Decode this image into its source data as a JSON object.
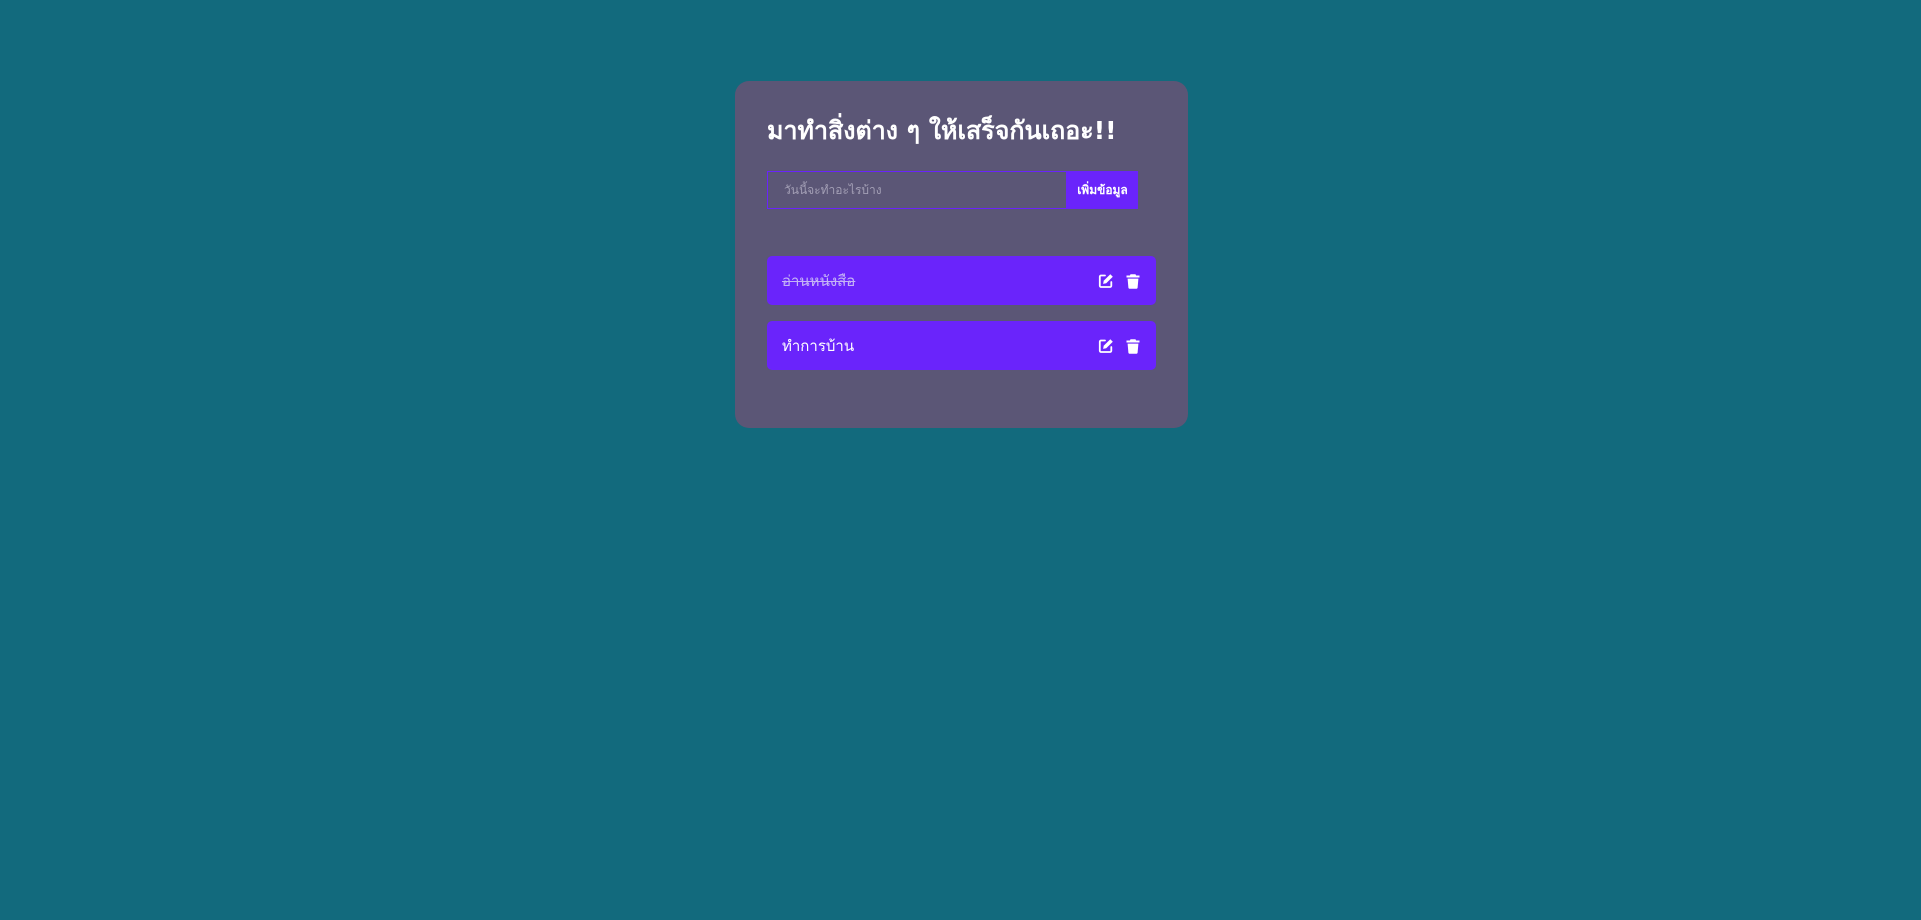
{
  "app": {
    "title": "มาทำสิ่งต่าง ๆ ให้เสร็จกันเถอะ!!",
    "colors": {
      "background": "#126a7d",
      "card": "#5b5676",
      "accent": "#6a24fb"
    }
  },
  "form": {
    "input_value": "",
    "placeholder": "วันนี้จะทำอะไรบ้าง",
    "add_label": "เพิ่มข้อมูล"
  },
  "todos": [
    {
      "text": "อ่านหนังสือ",
      "completed": true,
      "icons": [
        "edit-icon",
        "trash-icon"
      ]
    },
    {
      "text": "ทำการบ้าน",
      "completed": false,
      "icons": [
        "edit-icon",
        "trash-icon"
      ]
    }
  ]
}
